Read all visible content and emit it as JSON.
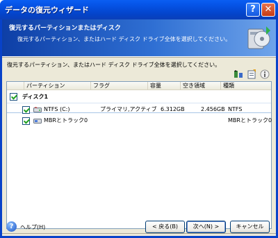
{
  "window": {
    "title": "データの復元ウィザード"
  },
  "header": {
    "title": "復元するパーティションまたはディスク",
    "subtitle": "復元するパーティション、またはハード ディスク ドライブ全体を選択してください。"
  },
  "instruction": "復元するパーティション、またはハード ディスク ドライブ全体を選択してください。",
  "toolbar": {
    "icons": [
      "sort-icon",
      "properties-icon",
      "info-icon"
    ]
  },
  "table": {
    "columns": [
      "パーティション",
      "フラグ",
      "容量",
      "空き領域",
      "種類"
    ],
    "disk": {
      "label": "ディスク1",
      "checked": true
    },
    "rows": [
      {
        "name": "NTFS (C:)",
        "flag": "プライマリ,アクティブ",
        "size": "6.312GB",
        "free": "2.456GB",
        "type": "NTFS",
        "checked": true
      },
      {
        "name": "MBRとトラック0",
        "flag": "",
        "size": "",
        "free": "",
        "type": "MBRとトラック0",
        "checked": true
      }
    ]
  },
  "footer": {
    "help_label": "ヘルプ(H)",
    "back_label": "< 戻る(B)",
    "next_label": "次へ(N) >",
    "cancel_label": "キャンセル"
  },
  "colors": {
    "titlebar": "#0552e4",
    "header_start": "#0e3fa6",
    "header_end": "#6fa4ea",
    "face": "#ece9d8"
  }
}
